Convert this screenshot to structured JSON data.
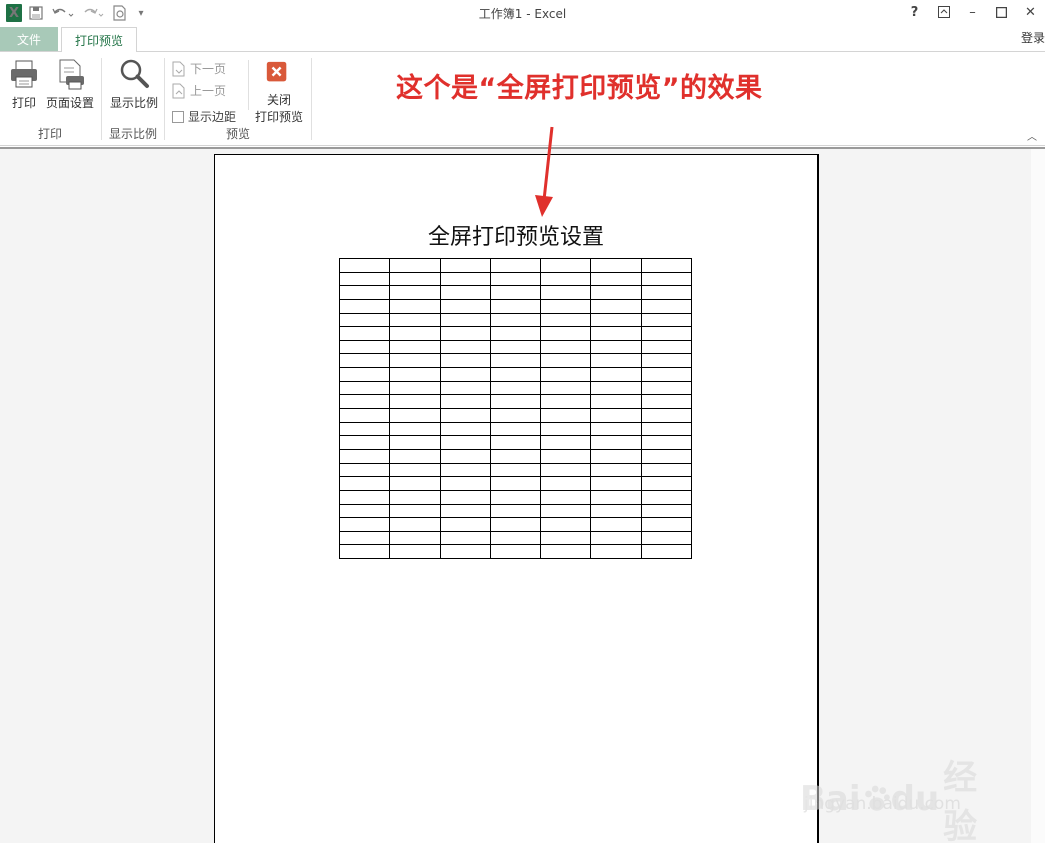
{
  "app": {
    "title": "工作簿1 - Excel",
    "icon": "excel-icon",
    "qat_icons": [
      "save-icon",
      "undo-icon",
      "redo-icon",
      "print-preview-icon",
      "customize-icon"
    ]
  },
  "window_controls": {
    "help": "?",
    "restore_ribbon": "▣",
    "minimize": "–",
    "maximize": "□",
    "close": "✕"
  },
  "tabs": {
    "file": "文件",
    "active": "打印预览",
    "sign_in": "登录"
  },
  "ribbon": {
    "groups": [
      {
        "label": "打印",
        "buttons": [
          {
            "label": "打印",
            "icon": "printer-icon"
          },
          {
            "label": "页面设置",
            "icon": "page-setup-icon"
          }
        ]
      },
      {
        "label": "显示比例",
        "buttons": [
          {
            "label": "显示比例",
            "icon": "zoom-icon"
          }
        ]
      },
      {
        "label": "预览",
        "buttons": [
          {
            "label": "下一页",
            "icon": "next-page-icon"
          },
          {
            "label": "上一页",
            "icon": "prev-page-icon"
          },
          {
            "label": "显示边距",
            "icon": "checkbox"
          },
          {
            "label_line1": "关闭",
            "label_line2": "打印预览",
            "icon": "close-preview-icon"
          }
        ]
      }
    ]
  },
  "annotation": {
    "text": "这个是“全屏打印预览”的效果",
    "color": "#e0302c"
  },
  "page": {
    "title": "全屏打印预览设置",
    "table": {
      "rows": 22,
      "cols": 7
    }
  },
  "watermark": {
    "brand_a": "Bai",
    "brand_b": "du",
    "brand_c": "经验",
    "url": "jingyan.baidu.com"
  },
  "colors": {
    "excel_green": "#217346",
    "file_tab": "#a8c9b8",
    "close_preview": "#d9593a"
  }
}
